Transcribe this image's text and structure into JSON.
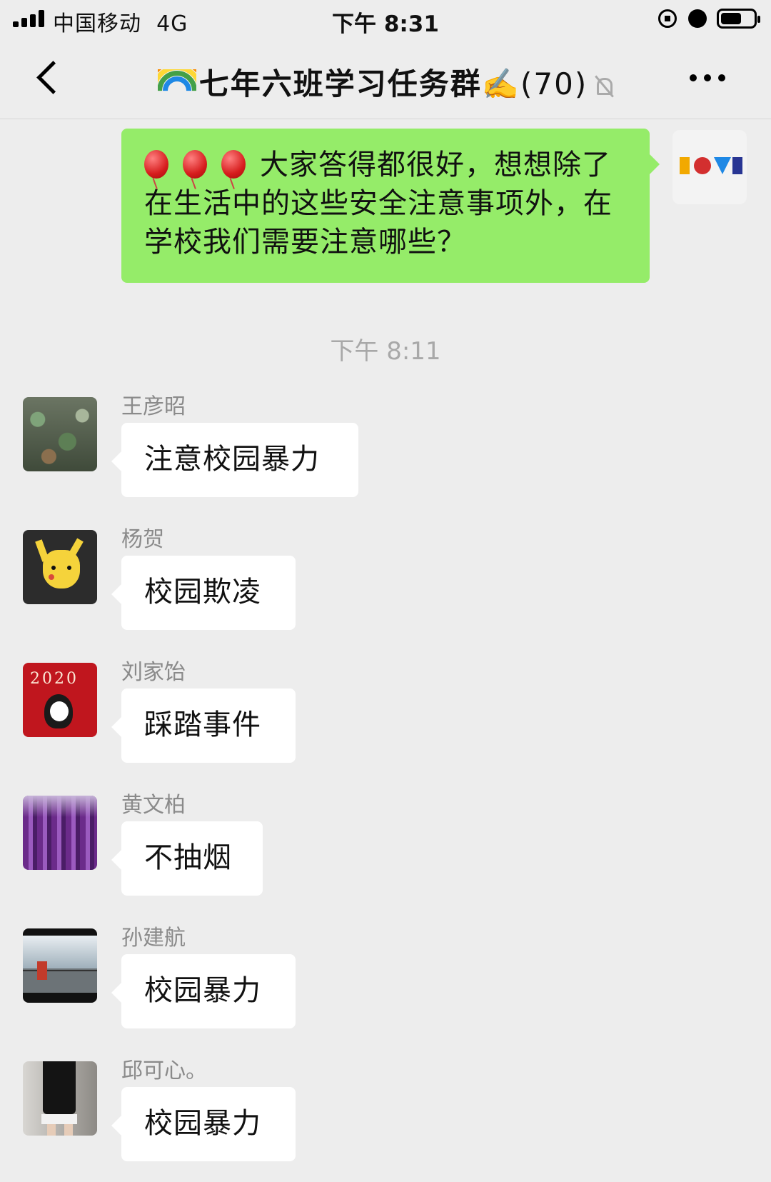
{
  "status_bar": {
    "carrier": "中国移动",
    "network": "4G",
    "time": "下午 8:31"
  },
  "nav": {
    "title": "七年六班学习任务群",
    "title_emoji": "✍️",
    "member_count": "(70)"
  },
  "own_message": {
    "text": "大家答得都很好，想想除了在生活中的这些安全注意事项外，在学校我们需要注意哪些？",
    "balloons": 3,
    "avatar_text": "LOVE"
  },
  "timestamp": "下午 8:11",
  "messages": [
    {
      "sender": "王彦昭",
      "text": "注意校园暴力",
      "avatar": "succulents-photo"
    },
    {
      "sender": "杨贺",
      "text": "校园欺凌",
      "avatar": "pikachu-drawing"
    },
    {
      "sender": "刘家饴",
      "text": "踩踏事件",
      "avatar": "girl-2020-red"
    },
    {
      "sender": "黄文柏",
      "text": "不抽烟",
      "avatar": "lavender-photo"
    },
    {
      "sender": "孙建航",
      "text": "校园暴力",
      "avatar": "video-still-railing"
    },
    {
      "sender": "邱可心。",
      "text": "校园暴力",
      "avatar": "person-stairs-photo"
    }
  ],
  "colors": {
    "background": "#ededed",
    "own_bubble": "#95ec69",
    "other_bubble": "#ffffff",
    "sender_name": "#8a8a8a",
    "timestamp": "#a8a8a8"
  }
}
